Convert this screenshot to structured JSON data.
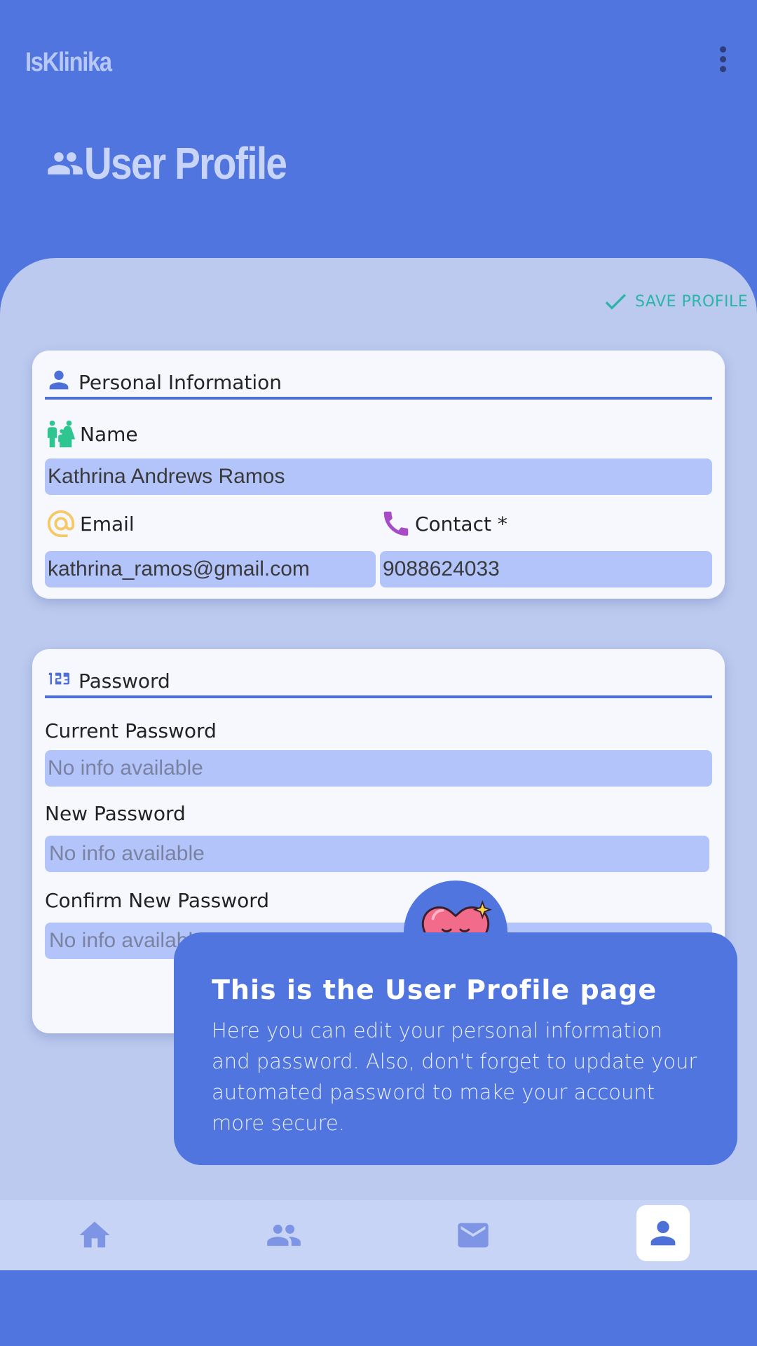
{
  "app": {
    "title": "IsKlinika"
  },
  "header": {
    "title": "User Profile"
  },
  "actions": {
    "save_label": "SAVE PROFILE"
  },
  "personal": {
    "section_title": "Personal Information",
    "name_label": "Name",
    "name_value": "Kathrina Andrews Ramos",
    "email_label": "Email",
    "email_value": "kathrina_ramos@gmail.com",
    "contact_label": "Contact *",
    "contact_value": "9088624033"
  },
  "password": {
    "section_title": "Password",
    "current_label": "Current Password",
    "current_placeholder": "No info available",
    "new_label": "New Password",
    "new_placeholder": "No info available",
    "confirm_label": "Confirm New Password",
    "confirm_placeholder": "No info available"
  },
  "tooltip": {
    "title": "This is the User Profile page",
    "text": "Here you can edit your personal information and password. Also, don't forget to update your automated password to make your account more secure."
  },
  "nav": {
    "items": [
      {
        "icon": "home-icon",
        "active": false
      },
      {
        "icon": "people-icon",
        "active": false
      },
      {
        "icon": "mail-icon",
        "active": false
      },
      {
        "icon": "person-icon",
        "active": true
      }
    ]
  },
  "colors": {
    "primary": "#5075df",
    "sheet": "#bccaef",
    "input": "#b3c4fb",
    "save_accent": "#2bb5a8",
    "name_icon": "#2fc590",
    "email_icon": "#f6c968",
    "contact_icon": "#a74bc9"
  }
}
